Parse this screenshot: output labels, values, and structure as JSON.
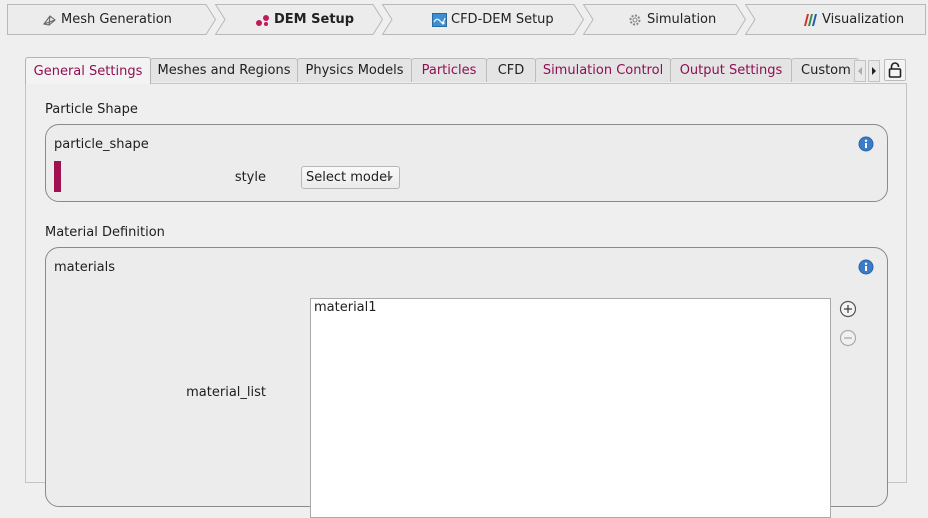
{
  "workflow": {
    "steps": [
      {
        "label": "Mesh Generation",
        "icon": "mesh-icon",
        "active": false
      },
      {
        "label": "DEM Setup",
        "icon": "dem-particles-icon",
        "active": true
      },
      {
        "label": "CFD-DEM Setup",
        "icon": "cfd-dem-icon",
        "active": false
      },
      {
        "label": "Simulation",
        "icon": "gear-icon",
        "active": false
      },
      {
        "label": "Visualization",
        "icon": "visualization-bars-icon",
        "active": false
      }
    ]
  },
  "tabs": {
    "items": [
      {
        "label": "General Settings"
      },
      {
        "label": "Meshes and Regions"
      },
      {
        "label": "Physics Models"
      },
      {
        "label": "Particles"
      },
      {
        "label": "CFD"
      },
      {
        "label": "Simulation Control"
      },
      {
        "label": "Output Settings"
      },
      {
        "label": "Custom"
      }
    ],
    "selected": "General Settings"
  },
  "particle_shape": {
    "section_title": "Particle Shape",
    "group_title": "particle_shape",
    "style_label": "style",
    "style_value": "Select model"
  },
  "material_definition": {
    "section_title": "Material Definition",
    "group_title": "materials",
    "list_label": "material_list",
    "items": [
      "material1"
    ]
  },
  "colors": {
    "accent": "#a0114f",
    "tab_text_magenta": "#8f0f52",
    "info_blue": "#2a63a8"
  }
}
